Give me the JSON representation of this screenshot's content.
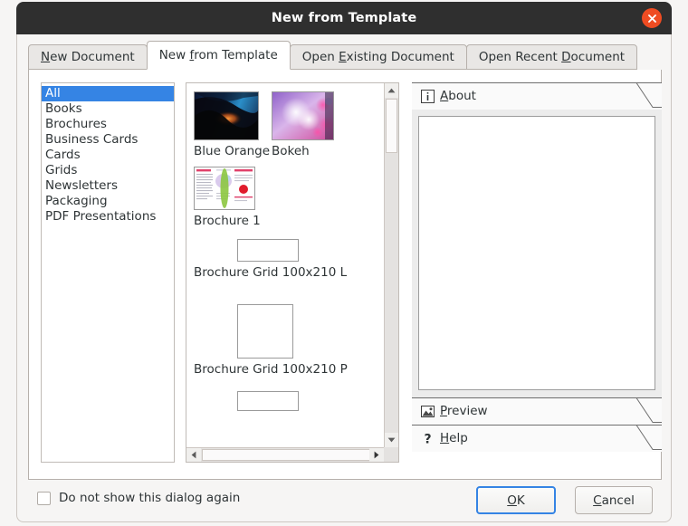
{
  "window": {
    "title": "New from Template",
    "close_icon": "close-icon"
  },
  "tabs": [
    {
      "label": "New Document",
      "mnemonic": "N",
      "active": false
    },
    {
      "label": "New from Template",
      "mnemonic": "f",
      "active": true
    },
    {
      "label": "Open Existing Document",
      "mnemonic": "E",
      "active": false
    },
    {
      "label": "Open Recent Document",
      "mnemonic": "D",
      "active": false
    }
  ],
  "categories": {
    "selected": "All",
    "items": [
      "All",
      "Books",
      "Brochures",
      "Business Cards",
      "Cards",
      "Grids",
      "Newsletters",
      "Packaging",
      "PDF Presentations"
    ]
  },
  "templates": [
    {
      "label": "Blue Orange",
      "kind": "image"
    },
    {
      "label": "Bokeh",
      "kind": "image"
    },
    {
      "label": "Brochure 1",
      "kind": "document"
    },
    {
      "label": "Brochure Grid 100x210 L",
      "kind": "grid-landscape"
    },
    {
      "label": "Brochure Grid 100x210 P",
      "kind": "grid-portrait"
    },
    {
      "label": "",
      "kind": "grid-landscape"
    }
  ],
  "panels": [
    {
      "title": "About",
      "mnemonic": "A",
      "icon": "info-icon",
      "expanded": true
    },
    {
      "title": "Preview",
      "mnemonic": "P",
      "icon": "image-icon",
      "expanded": false
    },
    {
      "title": "Help",
      "mnemonic": "H",
      "icon": "question-mark-icon",
      "expanded": false
    }
  ],
  "about_text": "",
  "footer": {
    "checkbox_label": "Do not show this dialog again",
    "checkbox_checked": false,
    "ok_label": "OK",
    "ok_mnemonic": "O",
    "cancel_label": "Cancel",
    "cancel_mnemonic": "C"
  },
  "colors": {
    "titlebar": "#2f2f2f",
    "close_button": "#ef4c22",
    "selection": "#3584e4",
    "dialog_bg": "#f6f5f4",
    "focus_ring": "#3584e4"
  }
}
